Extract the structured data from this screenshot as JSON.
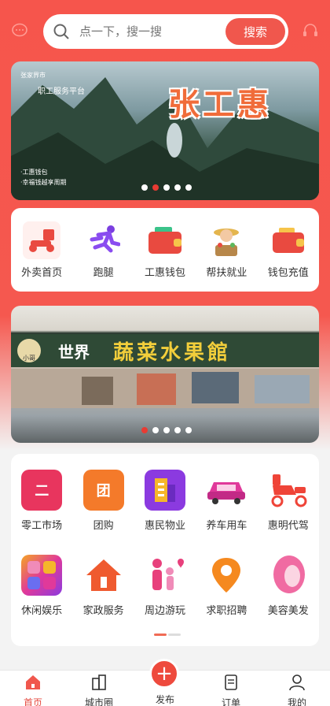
{
  "search": {
    "placeholder": "点一下，搜一搜",
    "button_label": "搜索"
  },
  "banner": {
    "brand": "张家界市",
    "platform": "职工服务平台",
    "title": "张工惠",
    "tag1": "·工惠钱包",
    "tag2": "·幸福钱越享周期"
  },
  "quick": [
    {
      "label": "外卖首页"
    },
    {
      "label": "跑腿"
    },
    {
      "label": "工惠钱包"
    },
    {
      "label": "帮扶就业"
    },
    {
      "label": "钱包充值"
    }
  ],
  "store": {
    "name1": "世界",
    "name2": "蔬菜水果館",
    "sign_small": "小哥"
  },
  "services_row1": [
    {
      "label": "零工市场",
      "glyph": "二"
    },
    {
      "label": "团购",
      "glyph": "团"
    },
    {
      "label": "惠民物业",
      "glyph": ""
    },
    {
      "label": "养车用车",
      "glyph": ""
    },
    {
      "label": "惠明代驾",
      "glyph": ""
    }
  ],
  "services_row2": [
    {
      "label": "休闲娱乐"
    },
    {
      "label": "家政服务"
    },
    {
      "label": "周边游玩"
    },
    {
      "label": "求职招聘"
    },
    {
      "label": "美容美发"
    }
  ],
  "tabbar": [
    {
      "label": "首页"
    },
    {
      "label": "城市圈"
    },
    {
      "label": "发布"
    },
    {
      "label": "订单"
    },
    {
      "label": "我的"
    }
  ],
  "colors": {
    "accent": "#f0574d",
    "active": "#e64a3f"
  }
}
